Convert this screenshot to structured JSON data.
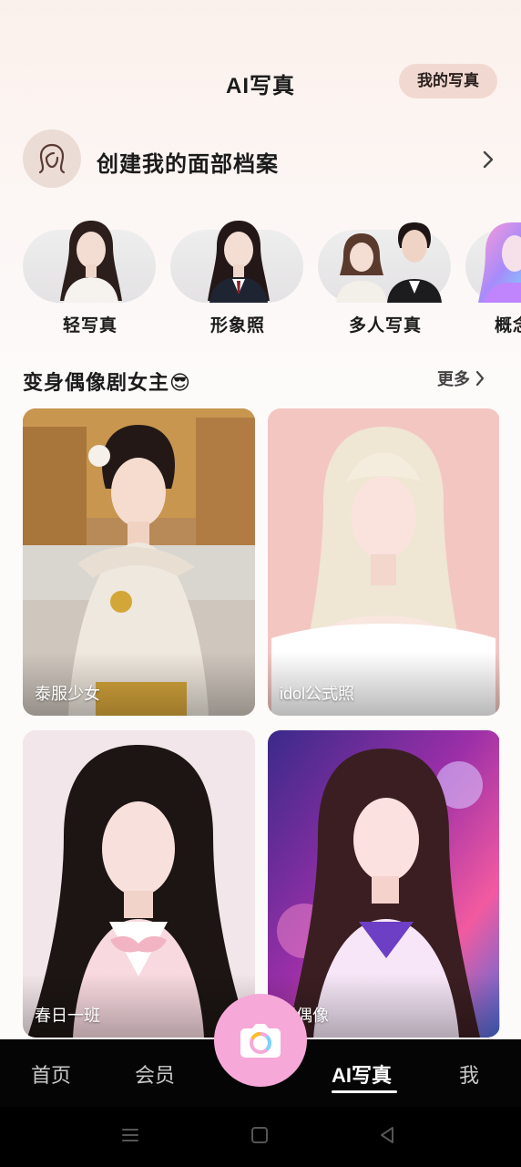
{
  "header": {
    "title": "AI写真",
    "my_photos_label": "我的写真"
  },
  "profile": {
    "title": "创建我的面部档案"
  },
  "categories": [
    {
      "label": "轻写真"
    },
    {
      "label": "形象照"
    },
    {
      "label": "多人写真"
    },
    {
      "label": "概念"
    }
  ],
  "section": {
    "title": "变身偶像剧女主😎",
    "more_label": "更多"
  },
  "cards": [
    {
      "label": "泰服少女"
    },
    {
      "label": "idol公式照"
    },
    {
      "label": "春日一班"
    },
    {
      "label": "团偶像"
    }
  ],
  "nav": {
    "home": "首页",
    "member": "会员",
    "ai_photo": "AI写真",
    "me": "我"
  },
  "colors": {
    "accent_pink": "#f6a8d8",
    "button_bg": "#f1d9d1",
    "nav_bg": "#050505"
  }
}
